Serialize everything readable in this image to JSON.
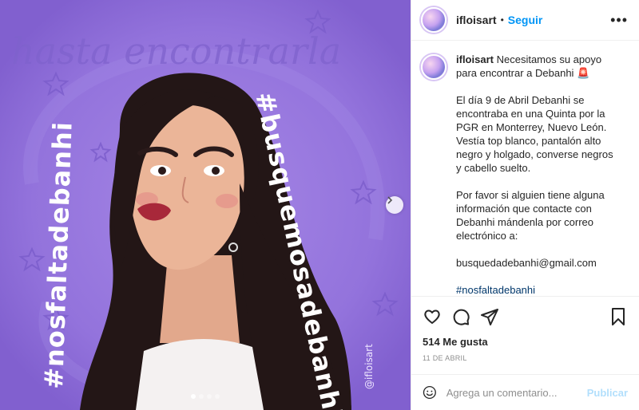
{
  "post": {
    "image": {
      "top_text": "hasta encontrarla",
      "right_text": "#busquemosadebanhi",
      "left_text": "#nosfaltadebanhi",
      "signature": "@ifloisart",
      "background_color": "#8c6ad6",
      "carousel_dots": 4,
      "active_dot": 0
    },
    "header": {
      "username": "ifloisart",
      "separator": "•",
      "follow_label": "Seguir",
      "more_icon": "more-options-icon"
    },
    "caption": {
      "username": "ifloisart",
      "intro": "Necesitamos su apoyo para encontrar a Debanhi 🚨",
      "para1": "El día 9 de Abril Debanhi se encontraba en una Quinta por la PGR en Monterrey, Nuevo León.\nVestía top blanco, pantalón alto negro y holgado, converse negros y cabello suelto.",
      "para2": "Por favor si alguien tiene alguna información que contacte con Debanhi mándenla por correo electrónico a:",
      "email": "busquedadebanhi@gmail.com",
      "hashtags": "#nosfaltadebanhi\n#busquemosadebanhi #desaparecida\n#nuevoleon #niunamenos #niunamas\n#mexico #arteconfeminista"
    },
    "actions": {
      "like_icon": "heart-icon",
      "comment_icon": "comment-icon",
      "share_icon": "share-icon",
      "save_icon": "bookmark-icon"
    },
    "likes": "514 Me gusta",
    "date": "11 DE ABRIL",
    "comment_box": {
      "emoji_icon": "emoji-icon",
      "placeholder": "Agrega un comentario...",
      "post_label": "Publicar"
    }
  }
}
